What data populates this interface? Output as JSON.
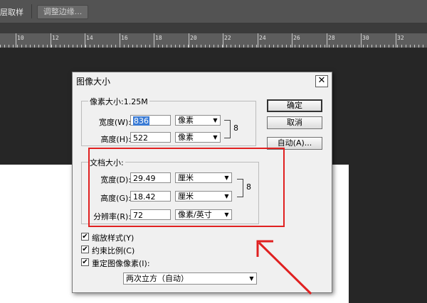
{
  "toolbar": {
    "sample_label": "层取样",
    "adjust_edge_label": "调整边缘..."
  },
  "ruler": {
    "numbers": [
      "10",
      "12",
      "14",
      "16",
      "18",
      "20",
      "22",
      "24",
      "26",
      "28",
      "30",
      "32"
    ]
  },
  "dialog": {
    "title": "图像大小",
    "close_glyph": "✕",
    "pixel_group": {
      "title": "像素大小:1.25M",
      "width_label": "宽度(W):",
      "width_value": "836",
      "width_unit": "像素",
      "height_label": "高度(H):",
      "height_value": "522",
      "height_unit": "像素"
    },
    "doc_group": {
      "title": "文档大小:",
      "width_label": "宽度(D):",
      "width_value": "29.49",
      "width_unit": "厘米",
      "height_label": "高度(G):",
      "height_value": "18.42",
      "height_unit": "厘米",
      "res_label": "分辨率(R):",
      "res_value": "72",
      "res_unit": "像素/英寸"
    },
    "buttons": {
      "ok": "确定",
      "cancel": "取消",
      "auto": "自动(A)..."
    },
    "options": {
      "scale_styles": "缩放样式(Y)",
      "constrain": "约束比例(C)",
      "resample": "重定图像像素(I):",
      "resample_method": "两次立方（自动）"
    }
  },
  "colors": {
    "highlight_box": "#e02020",
    "arrow": "#e02020",
    "selection": "#3a7bd5"
  }
}
